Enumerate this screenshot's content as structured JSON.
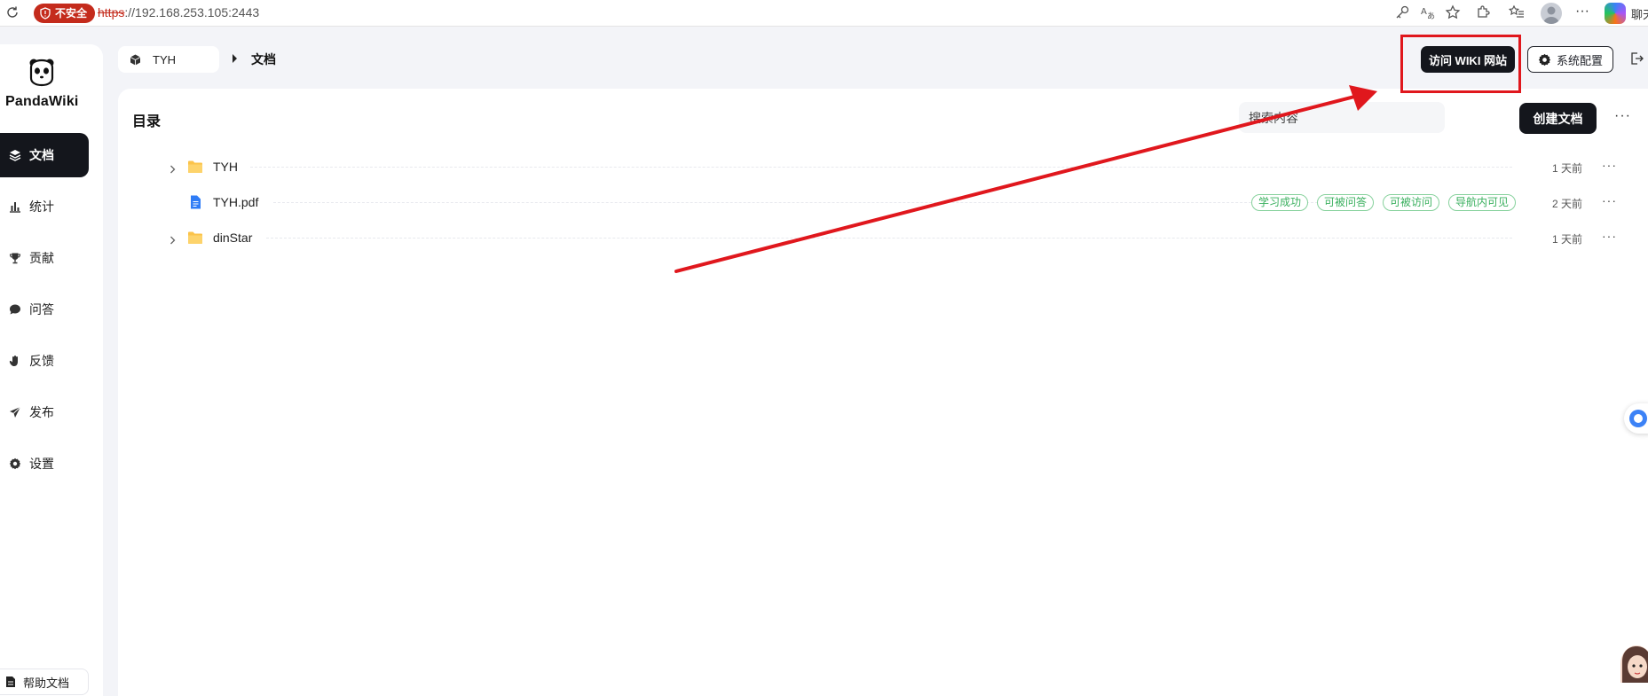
{
  "browser": {
    "insecure_label": "不安全",
    "url_protocol": "https",
    "url_rest": "://192.168.253.105:2443",
    "chat_label": "聊天"
  },
  "sidebar": {
    "brand": "PandaWiki",
    "items": [
      {
        "label": "文档",
        "icon": "layers-icon",
        "active": true
      },
      {
        "label": "统计",
        "icon": "bar-chart-icon"
      },
      {
        "label": "贡献",
        "icon": "trophy-icon"
      },
      {
        "label": "问答",
        "icon": "chat-bubble-icon"
      },
      {
        "label": "反馈",
        "icon": "hand-icon"
      },
      {
        "label": "发布",
        "icon": "send-icon"
      },
      {
        "label": "设置",
        "icon": "gear-icon"
      }
    ],
    "help_label": "帮助文档"
  },
  "header": {
    "kb_name": "TYH",
    "current_page": "文档",
    "visit_wiki_label": "访问 WIKI 网站",
    "system_config_label": "系统配置"
  },
  "main": {
    "title": "目录",
    "search_placeholder": "搜索内容",
    "create_label": "创建文档",
    "more_label": "···",
    "rows": [
      {
        "name": "TYH",
        "type": "folder",
        "time": "1 天前",
        "tags": []
      },
      {
        "name": "TYH.pdf",
        "type": "file",
        "time": "2 天前",
        "tags": [
          "学习成功",
          "可被问答",
          "可被访问",
          "导航内可见"
        ]
      },
      {
        "name": "dinStar",
        "type": "folder",
        "time": "1 天前",
        "tags": []
      }
    ]
  },
  "colors": {
    "accent_dark": "#14161c",
    "annotation_red": "#e0171d",
    "tag_green": "#3bb05f",
    "folder_yellow": "#fbc34a",
    "file_blue": "#2f7cf6"
  }
}
